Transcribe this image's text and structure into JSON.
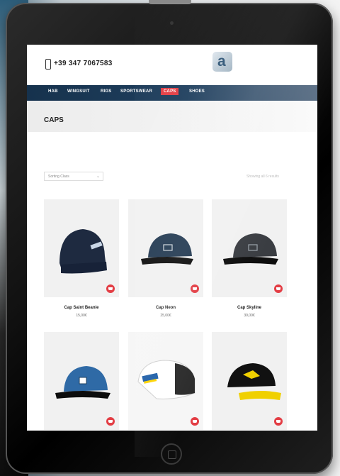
{
  "header": {
    "phone": "+39 347 7067583",
    "logo_letter": "a"
  },
  "nav": {
    "items": [
      {
        "label": "HAB",
        "active": false
      },
      {
        "label": "WINGSUIT",
        "active": false
      },
      {
        "label": "RIGS",
        "active": false
      },
      {
        "label": "SPORTSWEAR",
        "active": false
      },
      {
        "label": "CAPS",
        "active": true
      },
      {
        "label": "SHOES",
        "active": false
      }
    ]
  },
  "page": {
    "title": "CAPS"
  },
  "shop": {
    "sort_label": "Sorting Class",
    "result_text": "Showing all 6 results",
    "products": [
      {
        "name": "Cap Saint Beanie",
        "price": "15,00€",
        "color": "#1e2a40",
        "style": "beanie"
      },
      {
        "name": "Cap Neon",
        "price": "25,00€",
        "color": "#233a52",
        "style": "snapback"
      },
      {
        "name": "Cap Skyline",
        "price": "30,00€",
        "color": "#3a3d42",
        "style": "snapback"
      },
      {
        "name": "",
        "price": "",
        "color": "#2f6aa6",
        "style": "snapback"
      },
      {
        "name": "",
        "price": "",
        "color": "#ffffff",
        "style": "trucker"
      },
      {
        "name": "",
        "price": "",
        "color": "#111111",
        "style": "yellow"
      }
    ]
  },
  "colors": {
    "accent": "#e33e45",
    "nav": "#1f3f5e"
  }
}
